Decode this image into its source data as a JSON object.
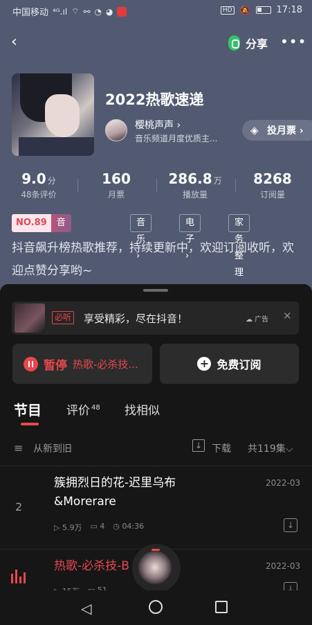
{
  "status_bar": {
    "carrier": "中国移动",
    "signal": "⁴ᴳ.ıl",
    "time": "17:18",
    "hd": "HD"
  },
  "nav": {
    "back_icon": "chevron-left-icon",
    "share_label": "分享",
    "more_icon": "more-dots-icon",
    "more_glyph": "•••"
  },
  "album": {
    "title": "2022热歌速递",
    "author_name": "樱桃声声 ›",
    "author_desc": "音乐频道月度优质主...",
    "vote_label": "投月票 ›"
  },
  "stats": [
    {
      "value": "9.0",
      "unit": "分",
      "label": "48条评价"
    },
    {
      "value": "160",
      "unit": "",
      "label": "月票"
    },
    {
      "value": "286.8",
      "unit": "万",
      "label": "播放量"
    },
    {
      "value": "8268",
      "unit": "",
      "label": "订阅量"
    }
  ],
  "tags": {
    "rank_no": "NO.89",
    "rank_chart": "音乐 日常榜 ›",
    "items": [
      "音乐 ›",
      "电子 ›",
      "家务整理 ›"
    ]
  },
  "description": "抖音飙升榜热歌推荐，持续更新中，欢迎订阅收听，欢迎点赞分享哟~",
  "ad": {
    "badge": "必听",
    "text": "享受精彩，尽在抖音！",
    "tag": "☁ 广告",
    "close": "✕"
  },
  "actions": {
    "pause_label": "暂停",
    "pause_track": "热歌-必杀技...",
    "subscribe_label": "免费订阅"
  },
  "tabs": {
    "programs": "节目",
    "reviews": "评价",
    "reviews_count": "48",
    "similar": "找相似"
  },
  "sortbar": {
    "sort_label": "从新到旧",
    "download_label": "下载",
    "count_label": "共119集⌵"
  },
  "tracks": [
    {
      "num": "2",
      "title": "簇拥烈日的花-迟里乌布&Morerare",
      "date": "2022-03",
      "plays": "▷ 5.9万",
      "comments": "▭ 4",
      "duration": "◷ 04:36",
      "playing": false
    },
    {
      "num": "",
      "title": "热歌-必杀技-B",
      "date": "2022-03",
      "plays": "▷ 15万",
      "comments": "▭ 51",
      "duration": "",
      "playing": true
    }
  ],
  "colors": {
    "header_bg": "#525a71",
    "sheet_bg": "#161616",
    "accent_red": "#e8474d"
  }
}
